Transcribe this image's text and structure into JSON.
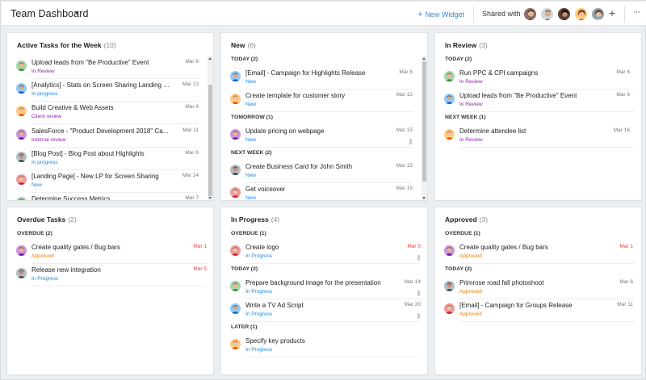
{
  "header": {
    "title": "Team Dashboard",
    "new_widget_label": "New Widget",
    "shared_label": "Shared with",
    "add_icon": "+",
    "more_icon": "···"
  },
  "colors": {
    "in_review": "#8e24aa",
    "in_progress": "#1e88e5",
    "new": "#1e88e5",
    "client_review": "#8e24aa",
    "internal_review": "#8e24aa",
    "approved": "#f57c00",
    "overdue_date": "#e53935"
  },
  "panels": {
    "active": {
      "title": "Active Tasks for the Week",
      "count": "(10)",
      "tasks": [
        {
          "name": "Upload leads from \"Be Productive\" Event",
          "status": "In Review",
          "date": "Mar 6"
        },
        {
          "name": "[Analytics] - Stats on Screen Sharing Landing P...",
          "status": "In progress",
          "date": "Mar 13"
        },
        {
          "name": "Build Creative & Web Assets",
          "status": "Client review",
          "date": "Mar 8"
        },
        {
          "name": "SalesForce - \"Product Development 2018\" Ca...",
          "status": "Internal review",
          "date": "Mar 11"
        },
        {
          "name": "[Blog Post] - Blog Post about Highlights",
          "status": "In progress",
          "date": "Mar 6"
        },
        {
          "name": "[Landing Page] - New LP for Screen Sharing",
          "status": "New",
          "date": "Mar 14"
        },
        {
          "name": "Determine Success Metrics",
          "status": "",
          "date": "Mar 7"
        }
      ]
    },
    "new": {
      "title": "New",
      "count": "(6)",
      "sections": [
        {
          "label": "TODAY (2)",
          "tasks": [
            {
              "name": "[Email] - Campaign for Highlights Release",
              "status": "New",
              "date": "Mar 6"
            },
            {
              "name": "Create template for customer story",
              "status": "New",
              "date": "Mar 12"
            }
          ]
        },
        {
          "label": "TOMORROW (1)",
          "tasks": [
            {
              "name": "Update pricing on webpage",
              "status": "New",
              "date": "Mar 15"
            }
          ]
        },
        {
          "label": "NEXT WEEK (2)",
          "tasks": [
            {
              "name": "Create Business Card for John Smith",
              "status": "New",
              "date": "Mar 15"
            },
            {
              "name": "Get voiceover",
              "status": "New",
              "date": "Mar 15"
            }
          ]
        }
      ]
    },
    "review": {
      "title": "In Review",
      "count": "(3)",
      "sections": [
        {
          "label": "TODAY (2)",
          "tasks": [
            {
              "name": "Run PPC & CPI campaigns",
              "status": "In Review",
              "date": "Mar 6"
            },
            {
              "name": "Upload leads from \"Be Productive\" Event",
              "status": "In Review",
              "date": "Mar 6"
            }
          ]
        },
        {
          "label": "NEXT WEEK (1)",
          "tasks": [
            {
              "name": "Determine attendee list",
              "status": "In Review",
              "date": "Mar 16"
            }
          ]
        }
      ]
    },
    "overdue": {
      "title": "Overdue Tasks",
      "count": "(2)",
      "sections": [
        {
          "label": "OVERDUE (2)",
          "tasks": [
            {
              "name": "Create quality gates / Bug bars",
              "status": "Approved",
              "date": "Mar 1"
            },
            {
              "name": "Release new integration",
              "status": "In Progress",
              "date": "Mar 5"
            }
          ]
        }
      ]
    },
    "progress": {
      "title": "In Progress",
      "count": "(4)",
      "sections": [
        {
          "label": "OVERDUE (1)",
          "tasks": [
            {
              "name": "Create logo",
              "status": "In Progress",
              "date": "Mar 5"
            }
          ]
        },
        {
          "label": "TODAY (2)",
          "tasks": [
            {
              "name": "Prepare background image for the presentation",
              "status": "In Progress",
              "date": "Mar 14"
            },
            {
              "name": "Write a TV Ad Script",
              "status": "In Progress",
              "date": "Mar 20"
            }
          ]
        },
        {
          "label": "LATER (1)",
          "tasks": [
            {
              "name": "Specify key products",
              "status": "In Progress",
              "date": ""
            }
          ]
        }
      ]
    },
    "approved": {
      "title": "Approved",
      "count": "(3)",
      "sections": [
        {
          "label": "OVERDUE (1)",
          "tasks": [
            {
              "name": "Create quality gates / Bug bars",
              "status": "Approved",
              "date": "Mar 1"
            }
          ]
        },
        {
          "label": "TODAY (2)",
          "tasks": [
            {
              "name": "Primrose road fall photoshoot",
              "status": "Approved",
              "date": "Mar 6"
            },
            {
              "name": "[Email] - Campaign for Groups Release",
              "status": "Approved",
              "date": "Mar 11"
            }
          ]
        }
      ]
    }
  }
}
